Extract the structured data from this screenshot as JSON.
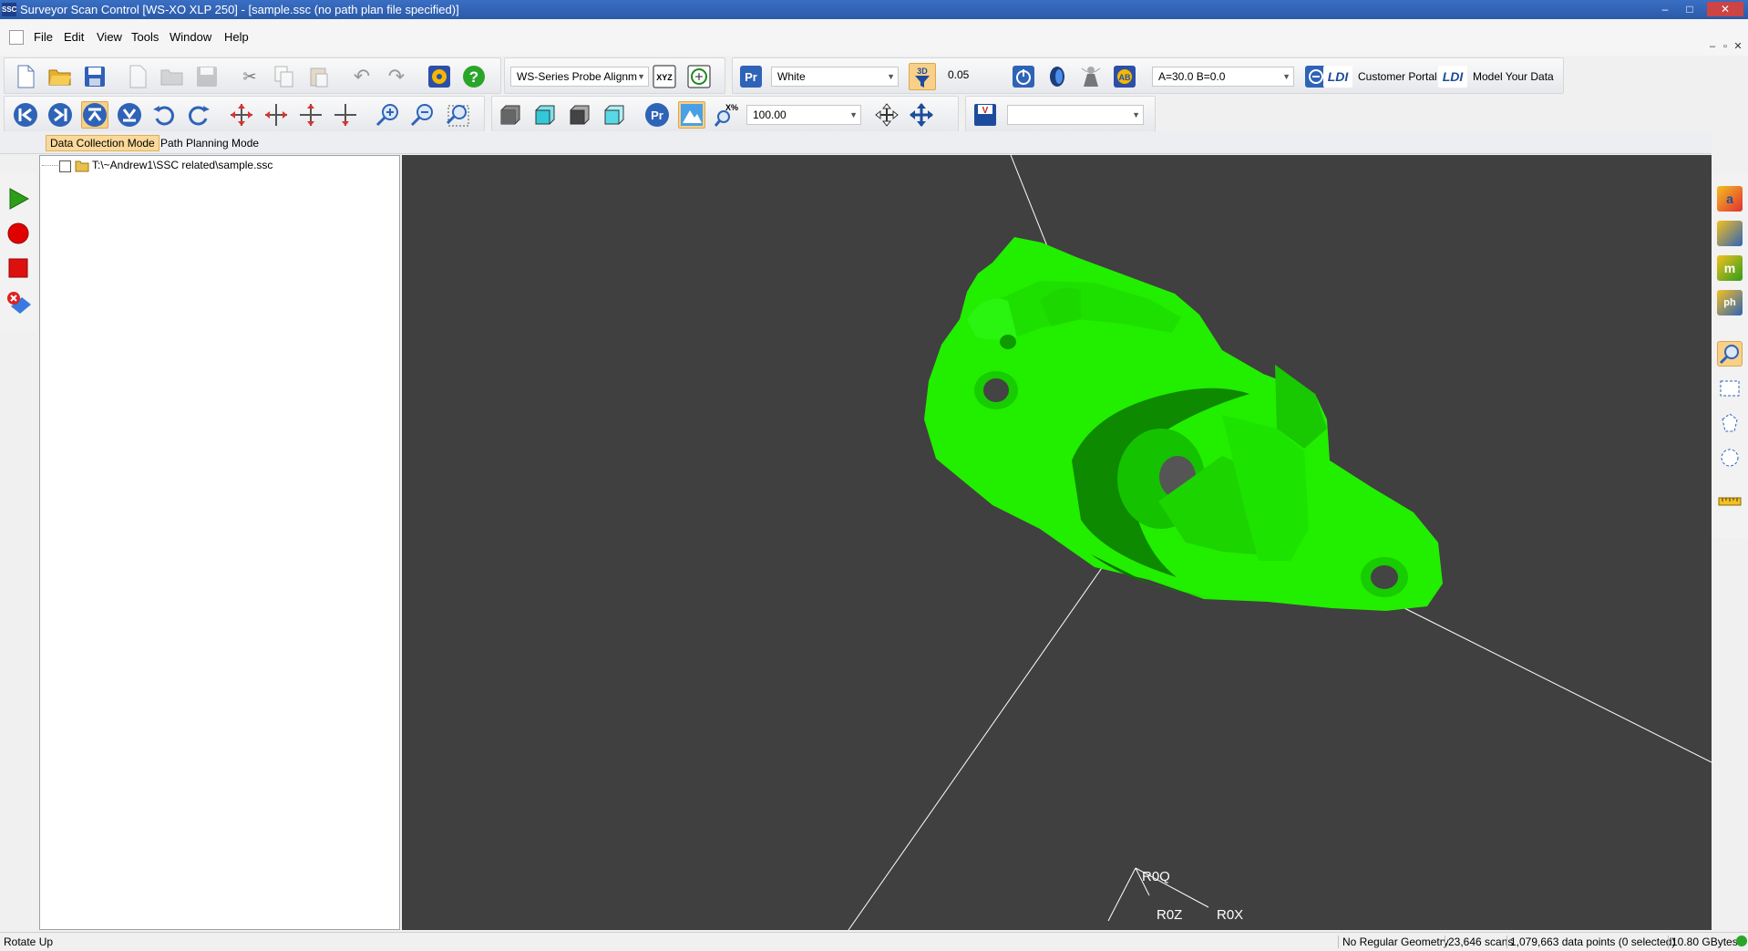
{
  "window": {
    "title": "Surveyor Scan Control [WS-XO XLP 250] - [sample.ssc (no path plan file specified)]",
    "app_icon_text": "SSC",
    "minimize": "–",
    "maximize": "□",
    "close": "✕"
  },
  "menu": {
    "items": [
      "File",
      "Edit",
      "View",
      "Tools",
      "Window",
      "Help"
    ],
    "mdi_minimize": "–",
    "mdi_restore": "▫",
    "mdi_close": "✕"
  },
  "toolbar1": {
    "probe_alignment": "WS-Series Probe Alignm",
    "material_color": "White",
    "filter_value": "0.05",
    "angles": "A=30.0  B=0.0",
    "customer_portal": "Customer Portal",
    "model_your_data": "Model Your Data",
    "ldi_logo_text": "LDI",
    "pr_label": "Pr",
    "threed_label": "3D",
    "xyz_label": "XYZ"
  },
  "toolbar2": {
    "zoom_value": "100.00",
    "zoom_pct_label": "X%",
    "pr_label": "Pr",
    "save_mark": "V",
    "dropdown_value": ""
  },
  "modes": {
    "data_collection": "Data Collection Mode",
    "path_planning": "Path Planning Mode"
  },
  "tree": {
    "root_path": "T:\\~Andrew1\\SSC related\\sample.ssc"
  },
  "viewport": {
    "background": "#404040",
    "model_color": "#22ee00",
    "axis_origin_label": "R0Q",
    "axis_z_label": "R0Z",
    "axis_x_label": "R0X"
  },
  "right_tools": {
    "labels": [
      "a",
      "",
      "m",
      "ph"
    ]
  },
  "status": {
    "message": "Rotate Up",
    "geometry": "No Regular Geometry",
    "scans": "23,646 scans",
    "points": "1,079,663 data points (0 selected)",
    "size": "10.80 GBytes"
  },
  "colors": {
    "title_bar": "#2b5aa8",
    "active_tab": "#fad99a",
    "play": "#2e9e1a",
    "record": "#e00000",
    "stop": "#dd1010"
  }
}
